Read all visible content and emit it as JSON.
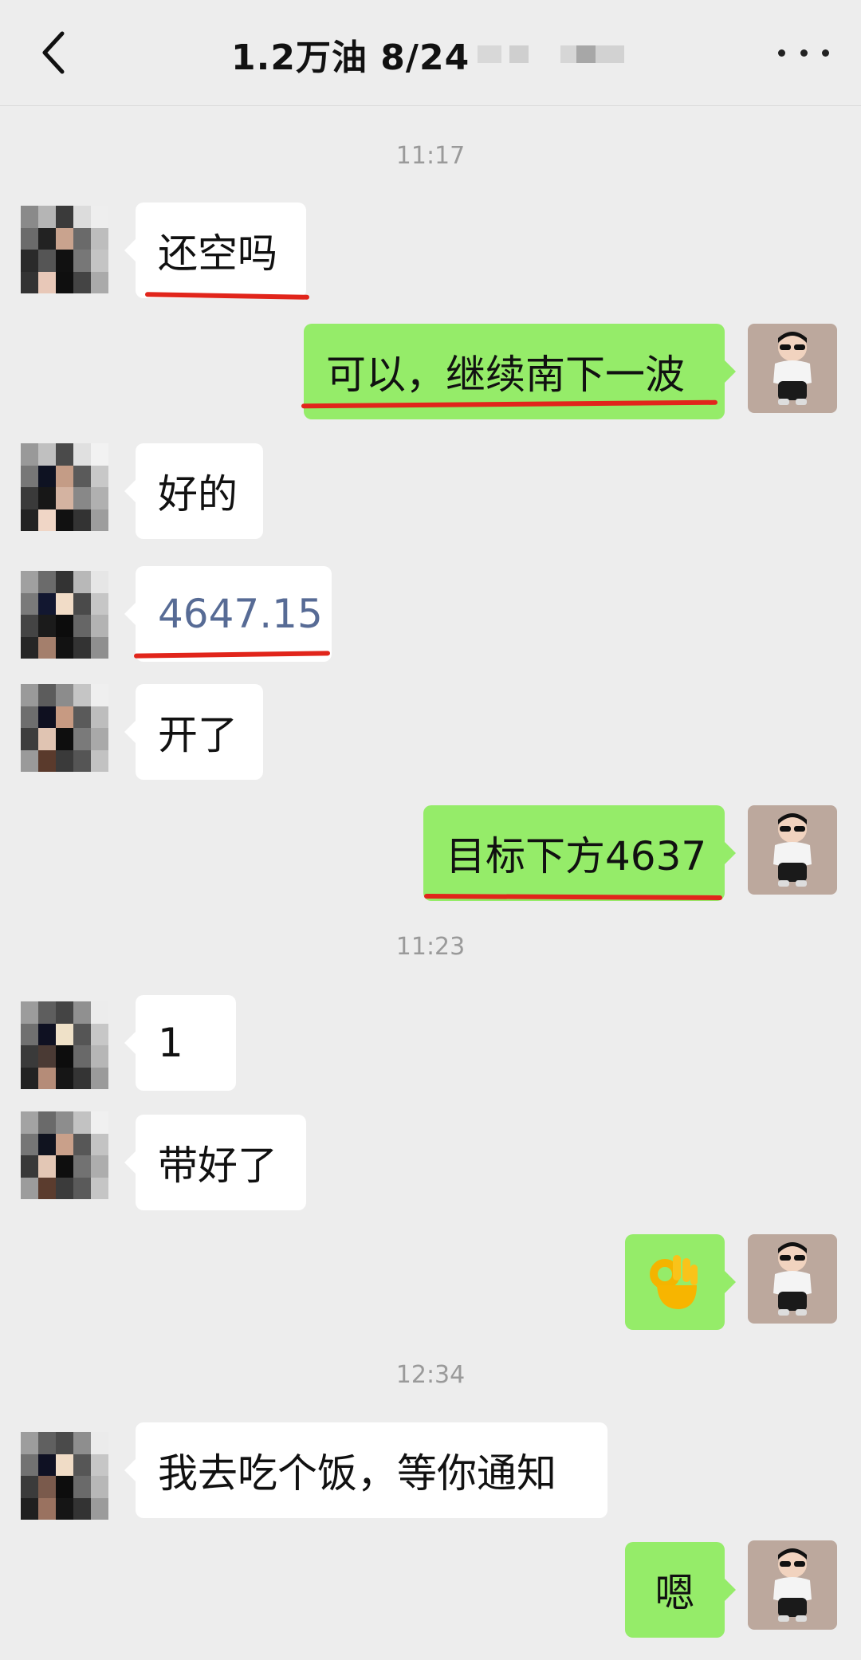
{
  "header": {
    "title": "1.2万油  8/24",
    "back_icon": "chevron-left-icon",
    "more_icon": "ellipsis-icon"
  },
  "colors": {
    "background": "#ededed",
    "sent_bubble": "#95ec69",
    "received_bubble": "#ffffff",
    "underline": "#e1251b",
    "link_text": "#576b95"
  },
  "messages": [
    {
      "type": "time",
      "text": "11:17"
    },
    {
      "type": "msg",
      "side": "left",
      "text": "还空吗"
    },
    {
      "type": "msg",
      "side": "right",
      "text": "可以，继续南下一波"
    },
    {
      "type": "msg",
      "side": "left",
      "text": "好的"
    },
    {
      "type": "msg",
      "side": "left",
      "text": "4647.15"
    },
    {
      "type": "msg",
      "side": "left",
      "text": "开了"
    },
    {
      "type": "msg",
      "side": "right",
      "text": "目标下方4637"
    },
    {
      "type": "time",
      "text": "11:23"
    },
    {
      "type": "msg",
      "side": "left",
      "text": "1"
    },
    {
      "type": "msg",
      "side": "left",
      "text": "带好了"
    },
    {
      "type": "msg",
      "side": "right",
      "text": "👌",
      "emoji_name": "ok-hand-emoji"
    },
    {
      "type": "time",
      "text": "12:34"
    },
    {
      "type": "msg",
      "side": "left",
      "text": "我去吃个饭，等你通知"
    },
    {
      "type": "msg",
      "side": "right",
      "text": "嗯"
    }
  ]
}
